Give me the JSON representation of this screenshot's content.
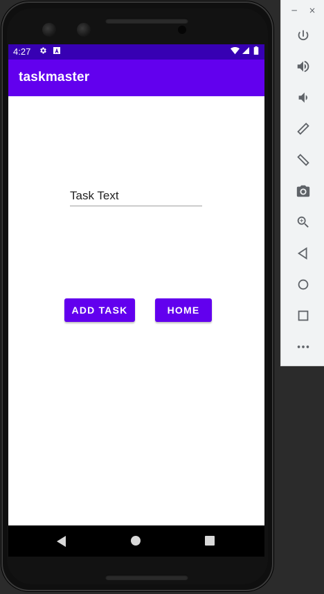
{
  "status_bar": {
    "time": "4:27",
    "icons": [
      "settings-icon",
      "text-icon",
      "wifi-icon",
      "signal-icon",
      "battery-icon"
    ]
  },
  "app_bar": {
    "title": "taskmaster"
  },
  "form": {
    "task_input": {
      "value": "Task Text",
      "placeholder": ""
    },
    "add_task_label": "Add Task",
    "home_label": "Home"
  },
  "emulator_panel": {
    "window_controls": [
      "−",
      "×"
    ],
    "buttons": [
      "power",
      "volume-up",
      "volume-down",
      "rotate-left",
      "rotate-right",
      "screenshot",
      "zoom",
      "back",
      "home",
      "overview",
      "more"
    ]
  },
  "colors": {
    "primary": "#6200ee",
    "primary_dark": "#3700b3",
    "background": "#ffffff"
  }
}
